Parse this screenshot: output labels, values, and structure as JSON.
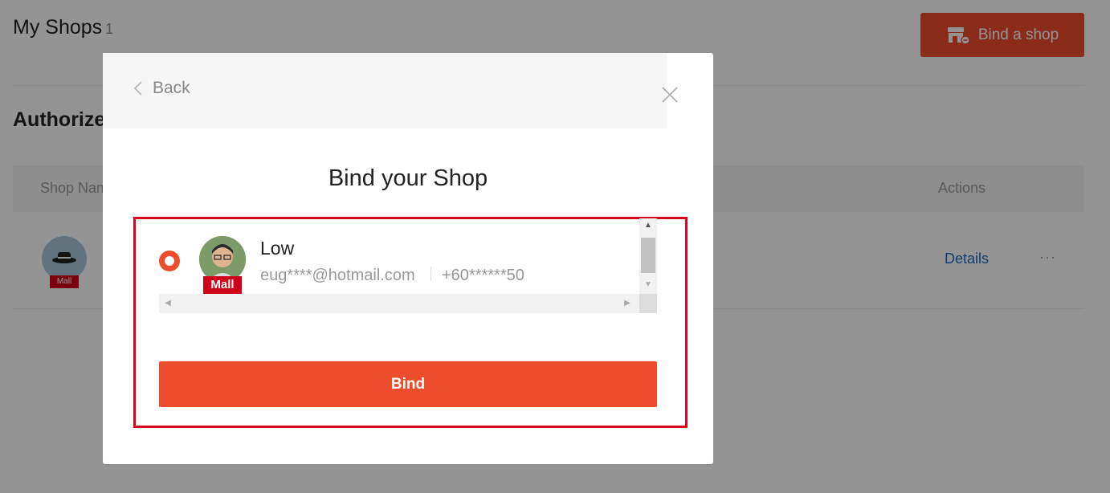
{
  "page": {
    "title": "My Shops",
    "count": "1",
    "section_title": "Authorized Shops",
    "bind_button_label": "Bind a shop",
    "table": {
      "headers": {
        "shop_name": "Shop Name",
        "actions": "Actions"
      },
      "rows": [
        {
          "badge": "Mall",
          "details_label": "Details",
          "more_label": "···"
        }
      ]
    }
  },
  "modal": {
    "back_label": "Back",
    "title": "Bind your Shop",
    "shops": [
      {
        "name": "Low",
        "email": "eug****@hotmail.com",
        "phone": "+60******50",
        "badge": "Mall",
        "selected": true
      }
    ],
    "bind_label": "Bind"
  },
  "colors": {
    "accent": "#ee4d2d",
    "highlight_border": "#d8051f",
    "link": "#1f66c7",
    "mall_badge": "#d0011b"
  }
}
